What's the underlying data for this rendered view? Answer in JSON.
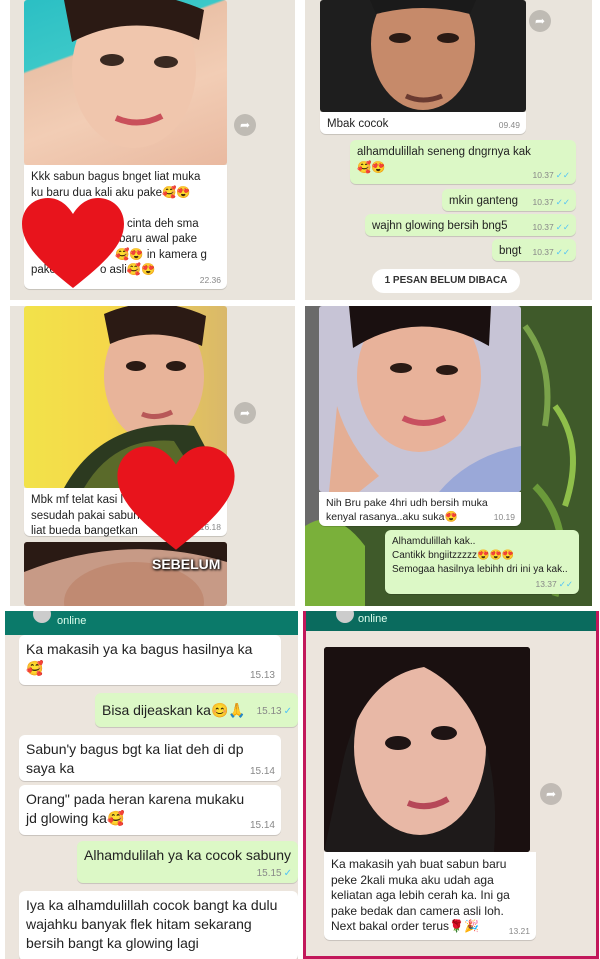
{
  "p1": {
    "msg1": "Kkk sabun bagus bnget liat muka ku baru dua kali aku pake🥰😍daah",
    "msg2": "cinta deh sma",
    "msg3": "baru awal pake",
    "msg4": "🥰😍 in kamera g",
    "msg5": "pake",
    "msg6": "o asli🥰😍",
    "time": "22.36"
  },
  "p2": {
    "caption": "Mbak cocok",
    "caption_time": "09.49",
    "r1": "alhamdulillah  seneng dngrnya kak 🥰😍",
    "r1_time": "10.37",
    "r2": "mkin ganteng",
    "r2_time": "10.37",
    "r3": "wajhn glowing bersih bng5",
    "r3_time": "10.37",
    "r4": "bngt",
    "r4_time": "10.37",
    "unread": "1 PESAN BELUM DIBACA"
  },
  "p3": {
    "msg": "Mbk mf telat kasi l",
    "msg2": "sesudah pakai sabun",
    "msg3": "liat bueda bangetkan",
    "time": "16.18",
    "label": "SEBELUM"
  },
  "p4": {
    "caption": "Nih Bru pake 4hri udh bersih muka kenyal rasanya..aku suka😍",
    "caption_time": "10.19",
    "reply1": "Alhamdulillah kak..",
    "reply2": "Cantikk bngiitzzzzz😍😍😍",
    "reply3": "Semogaa hasilnya lebihh dri ini ya kak..",
    "reply_time": "13.37"
  },
  "p5": {
    "status": "online",
    "m1": "Ka makasih ya ka bagus hasilnya ka 🥰",
    "m1_time": "15.13",
    "m2": "Bisa dijeaskan ka😊🙏",
    "m2_time": "15.13",
    "m3": "Sabun'y bagus bgt ka liat deh di dp saya ka",
    "m3_time": "15.14",
    "m4": "Orang\" pada heran karena mukaku jd glowing ka🥰",
    "m4_time": "15.14",
    "m5": "Alhamdulilah ya ka cocok sabuny",
    "m5_time": "15.15",
    "m6": "Iya ka alhamdulillah cocok bangt ka dulu wajahku banyak flek hitam sekarang bersih bangt ka glowing lagi"
  },
  "p6": {
    "status": "online",
    "msg": "Ka makasih yah buat sabun baru peke 2kali muka aku udah aga keliatan aga lebih cerah ka. Ini ga pake bedak dan camera asli loh. Next bakal order terus🌹🎉",
    "time": "13.21"
  },
  "colors": {
    "whatsapp_green": "#075e54",
    "outgoing": "#dcf8c6",
    "heart": "#e8141c"
  }
}
